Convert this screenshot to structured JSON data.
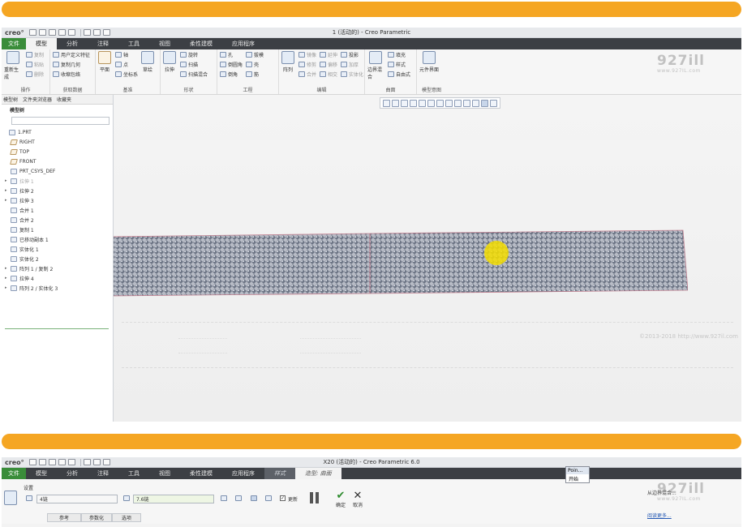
{
  "window1": {
    "logo": "creo°",
    "title": "1 (活动的) - Creo Parametric",
    "menu": [
      "文件",
      "模型",
      "分析",
      "注释",
      "工具",
      "视图",
      "柔性建模",
      "应用程序"
    ],
    "ribbon": {
      "operations": {
        "label": "操作",
        "regenerate": "重新生成",
        "copy": "复制",
        "paste": "粘贴",
        "delete": "删除"
      },
      "get_data": {
        "label": "获取数据",
        "udf": "用户定义特征",
        "copy_geom": "复制几何",
        "shrinkwrap": "收缩包络"
      },
      "datum": {
        "label": "基准",
        "plane": "平面",
        "axis": "轴",
        "point": "点",
        "csys": "坐标系",
        "sketch": "草绘"
      },
      "shapes": {
        "label": "形状",
        "extrude": "拉伸",
        "revolve": "旋转",
        "sweep": "扫描",
        "swept_blend": "扫描混合"
      },
      "engineering": {
        "label": "工程",
        "hole": "孔",
        "round": "倒圆角",
        "chamfer": "倒角",
        "draft": "拔模",
        "shell": "壳",
        "rib": "筋"
      },
      "editing": {
        "label": "编辑",
        "pattern": "阵列",
        "mirror": "镜像",
        "extend": "延伸",
        "project": "投影",
        "trim": "修剪",
        "offset": "偏移",
        "thicken": "加厚",
        "merge": "合并",
        "intersect": "相交",
        "solidify": "实体化"
      },
      "surfaces": {
        "label": "曲面",
        "boundary_blend": "边界混合",
        "fill": "填充",
        "style": "样式",
        "freestyle": "自由式"
      },
      "model_intent": {
        "label": "模型意图",
        "component_interface": "元件界面"
      }
    },
    "panel": {
      "tabs": [
        "模型树",
        "文件夹浏览器",
        "收藏夹"
      ],
      "header": "模型树",
      "tree": [
        {
          "label": "1.PRT",
          "expand": "",
          "dim": false
        },
        {
          "label": "RIGHT",
          "expand": "",
          "dim": false,
          "plane": true
        },
        {
          "label": "TOP",
          "expand": "",
          "dim": false,
          "plane": true
        },
        {
          "label": "FRONT",
          "expand": "",
          "dim": false,
          "plane": true
        },
        {
          "label": "PRT_CSYS_DEF",
          "expand": "",
          "dim": false
        },
        {
          "label": "拉伸 1",
          "expand": "▸",
          "dim": true
        },
        {
          "label": "拉伸 2",
          "expand": "▸",
          "dim": false
        },
        {
          "label": "拉伸 3",
          "expand": "▸",
          "dim": false
        },
        {
          "label": "合并 1",
          "expand": "",
          "dim": false
        },
        {
          "label": "合并 2",
          "expand": "",
          "dim": false
        },
        {
          "label": "复制 1",
          "expand": "",
          "dim": false
        },
        {
          "label": "已移动副本 1",
          "expand": "",
          "dim": false
        },
        {
          "label": "实体化 1",
          "expand": "",
          "dim": false
        },
        {
          "label": "实体化 2",
          "expand": "",
          "dim": false
        },
        {
          "label": "阵列 1 / 复制 2",
          "expand": "▸",
          "dim": false
        },
        {
          "label": "拉伸 4",
          "expand": "▸",
          "dim": false
        },
        {
          "label": "阵列 2 / 实体化 3",
          "expand": "▸",
          "dim": false
        }
      ]
    },
    "watermark": {
      "main": "927ill",
      "sub": "www.927IL.com"
    },
    "copyright": "©2013-2018 http://www.927il.com"
  },
  "window2": {
    "logo": "creo°",
    "title": "X20 (活动的) - Creo Parametric 6.0",
    "menu": [
      "文件",
      "模型",
      "分析",
      "注释",
      "工具",
      "视图",
      "柔性建模",
      "应用程序",
      "样式",
      "造型: 曲面"
    ],
    "settings_label": "设置",
    "field1_value": "4链",
    "field2_value": "7.6链",
    "update_label": "更新",
    "confirm_label": "确定",
    "cancel_label": "取消",
    "subtabs": [
      "参考",
      "参数化",
      "选项"
    ],
    "popup_title": "Poin...",
    "popup_item": "开始",
    "side_text": "从边界混合...",
    "learn_more": "阅读更多...",
    "watermark": {
      "main": "927ill",
      "sub": "www.927IL.com"
    }
  }
}
